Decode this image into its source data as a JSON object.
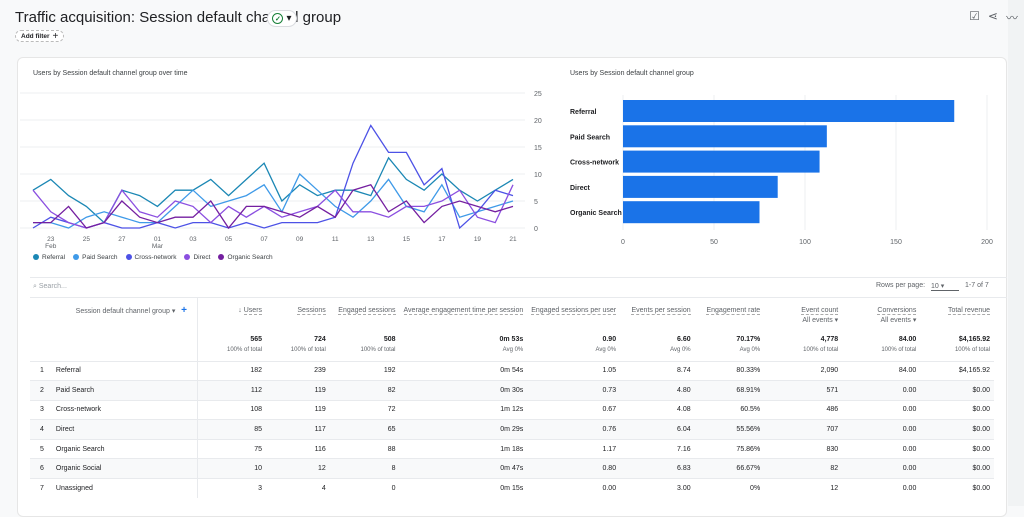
{
  "header": {
    "title": "Traffic acquisition: Session default channel group",
    "add_filter": "Add filter",
    "add_icon": "+",
    "status_icon": "check-circle",
    "icons": [
      "edit-report-icon",
      "share-icon",
      "insights-icon"
    ]
  },
  "colors": {
    "Referral": "#1b87b4",
    "Paid Search": "#3f9ae8",
    "Cross-network": "#4d52e6",
    "Direct": "#8b4fe0",
    "Organic Search": "#741fa0",
    "bar": "#1a73e8"
  },
  "chart_data": [
    {
      "type": "line",
      "title": "Users by Session default channel group over time",
      "x": [
        "Feb 22",
        "Feb 23",
        "Feb 24",
        "Feb 25",
        "Feb 26",
        "Feb 27",
        "Feb 28",
        "Mar 01",
        "Mar 02",
        "Mar 03",
        "Mar 04",
        "Mar 05",
        "Mar 06",
        "Mar 07",
        "Mar 08",
        "Mar 09",
        "Mar 10",
        "Mar 11",
        "Mar 12",
        "Mar 13",
        "Mar 14",
        "Mar 15",
        "Mar 16",
        "Mar 17",
        "Mar 18",
        "Mar 19",
        "Mar 20",
        "Mar 21"
      ],
      "x_tick_labels": [
        {
          "day": "23",
          "month": "Feb"
        },
        {
          "day": "25"
        },
        {
          "day": "27"
        },
        {
          "day": "01",
          "month": "Mar"
        },
        {
          "day": "03"
        },
        {
          "day": "05"
        },
        {
          "day": "07"
        },
        {
          "day": "09"
        },
        {
          "day": "11"
        },
        {
          "day": "13"
        },
        {
          "day": "15"
        },
        {
          "day": "17"
        },
        {
          "day": "19"
        },
        {
          "day": "21"
        }
      ],
      "y_ticks": [
        "0",
        "5",
        "10",
        "15",
        "20",
        "25"
      ],
      "ylim": [
        0,
        25
      ],
      "grid": true,
      "legend": "bottom-left",
      "series": [
        {
          "name": "Referral",
          "values": [
            7,
            9,
            6,
            4,
            1,
            7,
            6,
            4,
            7,
            7,
            9,
            6,
            9,
            12,
            5,
            8,
            6,
            7,
            7,
            6,
            13,
            9,
            7,
            10,
            7,
            5,
            7,
            9
          ]
        },
        {
          "name": "Paid Search",
          "values": [
            1,
            1,
            0,
            2,
            3,
            2,
            1,
            1,
            4,
            7,
            4,
            5,
            6,
            8,
            3,
            10,
            7,
            4,
            2,
            5,
            9,
            4,
            3,
            8,
            2,
            3,
            4,
            5
          ]
        },
        {
          "name": "Cross-network",
          "values": [
            0,
            2,
            1,
            0,
            1,
            0,
            0,
            1,
            0,
            1,
            1,
            0,
            1,
            0,
            1,
            1,
            1,
            2,
            12,
            19,
            14,
            14,
            8,
            11,
            0,
            3,
            7,
            6
          ]
        },
        {
          "name": "Direct",
          "values": [
            7,
            3,
            1,
            0,
            1,
            7,
            3,
            2,
            5,
            4,
            1,
            4,
            2,
            4,
            2,
            3,
            4,
            7,
            3,
            3,
            2,
            4,
            4,
            5,
            7,
            2,
            1,
            8
          ]
        },
        {
          "name": "Organic Search",
          "values": [
            1,
            1,
            4,
            0,
            1,
            5,
            2,
            1,
            2,
            2,
            5,
            0,
            4,
            4,
            3,
            2,
            4,
            2,
            7,
            8,
            3,
            5,
            1,
            4,
            5,
            4,
            3,
            4
          ]
        }
      ]
    },
    {
      "type": "bar",
      "orientation": "horizontal",
      "title": "Users by Session default channel group",
      "categories": [
        "Referral",
        "Paid Search",
        "Cross-network",
        "Direct",
        "Organic Search"
      ],
      "values": [
        182,
        112,
        108,
        85,
        75
      ],
      "x_ticks": [
        "0",
        "50",
        "100",
        "150",
        "200"
      ],
      "xlim": [
        0,
        200
      ],
      "grid": true
    }
  ],
  "table": {
    "search_placeholder": "Search...",
    "rows_per_page_label": "Rows per page:",
    "rows_per_page": "10",
    "pagination": "1-7 of 7",
    "dimension_header": "Session default channel group",
    "columns": [
      {
        "label": "Users",
        "sorted": true,
        "total": "565",
        "sub": "100% of total"
      },
      {
        "label": "Sessions",
        "total": "724",
        "sub": "100% of total"
      },
      {
        "label": "Engaged sessions",
        "total": "508",
        "sub": "100% of total"
      },
      {
        "label": "Average engagement time per session",
        "total": "0m 53s",
        "sub": "Avg 0%"
      },
      {
        "label": "Engaged sessions per user",
        "total": "0.90",
        "sub": "Avg 0%"
      },
      {
        "label": "Events per session",
        "total": "6.60",
        "sub": "Avg 0%"
      },
      {
        "label": "Engagement rate",
        "total": "70.17%",
        "sub": "Avg 0%"
      },
      {
        "label": "Event count",
        "filter": "All events",
        "total": "4,778",
        "sub": "100% of total"
      },
      {
        "label": "Conversions",
        "filter": "All events",
        "total": "84.00",
        "sub": "100% of total"
      },
      {
        "label": "Total revenue",
        "total": "$4,165.92",
        "sub": "100% of total"
      }
    ],
    "rows": [
      [
        "1",
        "Referral",
        "182",
        "239",
        "192",
        "0m 54s",
        "1.05",
        "8.74",
        "80.33%",
        "2,090",
        "84.00",
        "$4,165.92"
      ],
      [
        "2",
        "Paid Search",
        "112",
        "119",
        "82",
        "0m 30s",
        "0.73",
        "4.80",
        "68.91%",
        "571",
        "0.00",
        "$0.00"
      ],
      [
        "3",
        "Cross-network",
        "108",
        "119",
        "72",
        "1m 12s",
        "0.67",
        "4.08",
        "60.5%",
        "486",
        "0.00",
        "$0.00"
      ],
      [
        "4",
        "Direct",
        "85",
        "117",
        "65",
        "0m 29s",
        "0.76",
        "6.04",
        "55.56%",
        "707",
        "0.00",
        "$0.00"
      ],
      [
        "5",
        "Organic Search",
        "75",
        "116",
        "88",
        "1m 18s",
        "1.17",
        "7.16",
        "75.86%",
        "830",
        "0.00",
        "$0.00"
      ],
      [
        "6",
        "Organic Social",
        "10",
        "12",
        "8",
        "0m 47s",
        "0.80",
        "6.83",
        "66.67%",
        "82",
        "0.00",
        "$0.00"
      ],
      [
        "7",
        "Unassigned",
        "3",
        "4",
        "0",
        "0m 15s",
        "0.00",
        "3.00",
        "0%",
        "12",
        "0.00",
        "$0.00"
      ]
    ]
  }
}
